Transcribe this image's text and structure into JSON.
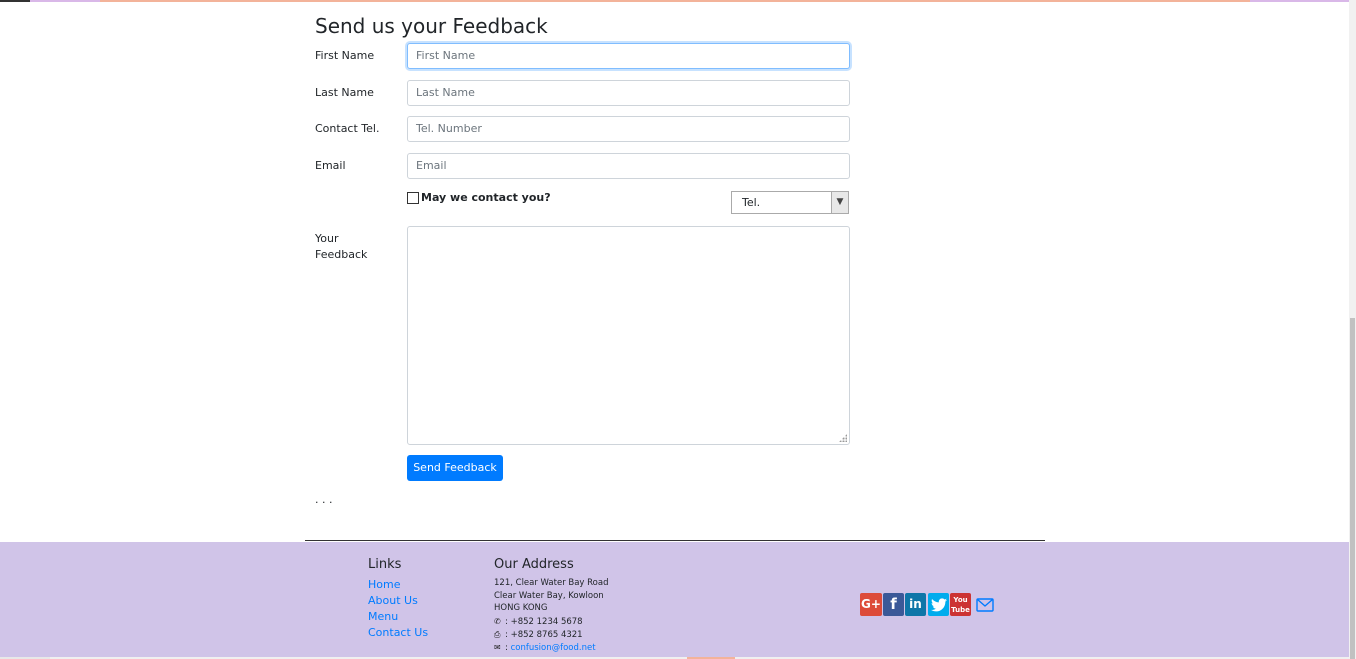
{
  "form": {
    "title": "Send us your Feedback",
    "first_name": {
      "label": "First Name",
      "placeholder": "First Name"
    },
    "last_name": {
      "label": "Last Name",
      "placeholder": "Last Name"
    },
    "telephone": {
      "label": "Contact Tel.",
      "placeholder": "Tel. Number"
    },
    "email": {
      "label": "Email",
      "placeholder": "Email"
    },
    "contact_checkbox_label": "May we contact you?",
    "contact_method_selected": "Tel.",
    "feedback_label_line1": "Your",
    "feedback_label_line2": "Feedback",
    "submit_label": "Send Feedback",
    "trailing_text": ". . ."
  },
  "footer": {
    "links_heading": "Links",
    "links": [
      "Home",
      "About Us",
      "Menu",
      "Contact Us"
    ],
    "address_heading": "Our Address",
    "address_lines": [
      "121, Clear Water Bay Road",
      "Clear Water Bay, Kowloon",
      "HONG KONG"
    ],
    "phone": "+852 1234 5678",
    "fax": "+852 8765 4321",
    "email": "confusion@food.net",
    "social": {
      "google_plus": "G+",
      "facebook": "f",
      "linkedin": "in",
      "youtube_top": "You",
      "youtube_bottom": "Tube"
    }
  },
  "colors": {
    "primary": "#007bff",
    "footer_bg": "#d0c4e8"
  },
  "icons": [
    "phone-icon",
    "fax-icon",
    "envelope-icon",
    "google-plus-icon",
    "facebook-icon",
    "linkedin-icon",
    "twitter-icon",
    "youtube-icon",
    "mail-icon"
  ]
}
